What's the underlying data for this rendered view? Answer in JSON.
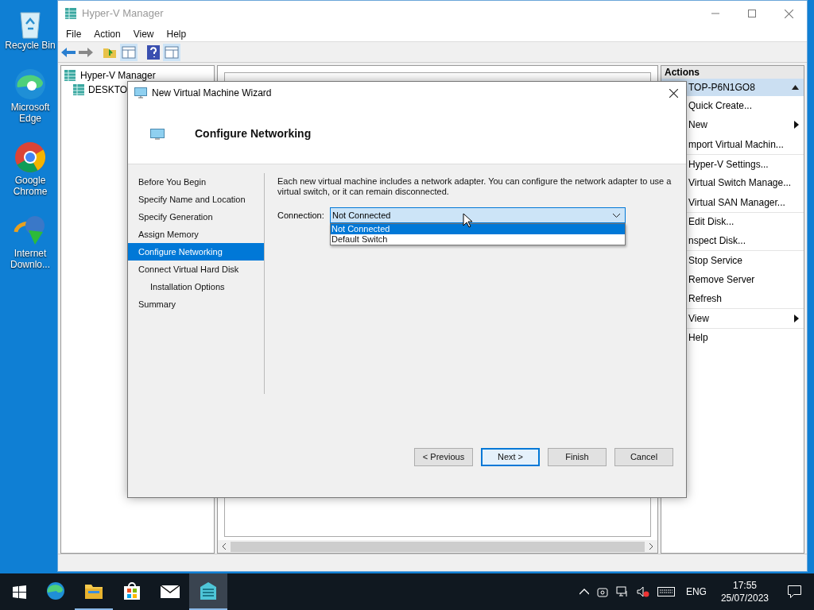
{
  "desktop_icons": [
    {
      "kind": "recycle",
      "label": "Recycle Bin"
    },
    {
      "kind": "edge",
      "label": "Microsoft Edge"
    },
    {
      "kind": "chrome",
      "label": "Google Chrome"
    },
    {
      "kind": "downloader",
      "label": "Internet Downlo..."
    }
  ],
  "main_window": {
    "title": "Hyper-V Manager",
    "menu": [
      "File",
      "Action",
      "View",
      "Help"
    ],
    "tree": {
      "label": "Hyper-V Manager",
      "children": [
        {
          "label": "DESKTO"
        }
      ]
    }
  },
  "actions": {
    "header": "Actions",
    "group": "TOP-P6N1GO8",
    "items": [
      {
        "label": "Quick Create...",
        "submenu": false
      },
      {
        "label": "New",
        "submenu": true
      },
      {
        "label": "mport Virtual Machin...",
        "submenu": false
      },
      {
        "label": "Hyper-V Settings...",
        "submenu": false
      },
      {
        "label": "Virtual Switch Manage...",
        "submenu": false
      },
      {
        "label": "Virtual SAN Manager...",
        "submenu": false
      },
      {
        "label": "Edit Disk...",
        "submenu": false
      },
      {
        "label": "nspect Disk...",
        "submenu": false
      },
      {
        "label": "Stop Service",
        "submenu": false
      },
      {
        "label": "Remove Server",
        "submenu": false
      },
      {
        "label": "Refresh",
        "submenu": false
      },
      {
        "label": "View",
        "submenu": true
      },
      {
        "label": "Help",
        "submenu": false
      }
    ]
  },
  "dialog": {
    "title": "New Virtual Machine Wizard",
    "heading": "Configure Networking",
    "steps": [
      {
        "label": "Before You Begin",
        "selected": false
      },
      {
        "label": "Specify Name and Location",
        "selected": false
      },
      {
        "label": "Specify Generation",
        "selected": false
      },
      {
        "label": "Assign Memory",
        "selected": false
      },
      {
        "label": "Configure Networking",
        "selected": true
      },
      {
        "label": "Connect Virtual Hard Disk",
        "selected": false,
        "children": [
          {
            "label": "Installation Options",
            "selected": false
          }
        ]
      },
      {
        "label": "Summary",
        "selected": false
      }
    ],
    "description": "Each new virtual machine includes a network adapter. You can configure the network adapter to use a virtual switch, or it can remain disconnected.",
    "connection": {
      "label": "Connection:",
      "value": "Not Connected",
      "expanded": true,
      "options": [
        {
          "label": "Not Connected",
          "selected": true
        },
        {
          "label": "Default Switch",
          "selected": false
        }
      ]
    },
    "buttons": [
      {
        "label": "< Previous",
        "default": false
      },
      {
        "label": "Next >",
        "default": true
      },
      {
        "label": "Finish",
        "default": false
      },
      {
        "label": "Cancel",
        "default": false
      }
    ]
  },
  "taskbar": {
    "apps": [
      {
        "kind": "edge",
        "running": false,
        "active": false
      },
      {
        "kind": "folder",
        "running": true,
        "active": false
      },
      {
        "kind": "store",
        "running": false,
        "active": false
      },
      {
        "kind": "mail",
        "running": false,
        "active": false
      },
      {
        "kind": "server",
        "running": true,
        "active": true
      }
    ],
    "language": "ENG",
    "time": "17:55",
    "date": "25/07/2023"
  }
}
